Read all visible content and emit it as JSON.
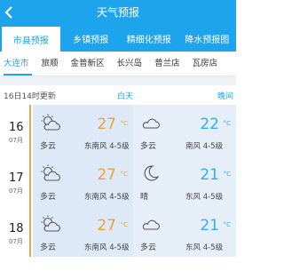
{
  "header": {
    "title": "天气预报"
  },
  "tabs": [
    {
      "label": "市县预报",
      "active": true
    },
    {
      "label": "乡镇预报",
      "active": false
    },
    {
      "label": "精细化预报",
      "active": false
    },
    {
      "label": "降水预报图",
      "active": false
    }
  ],
  "districts": [
    "大连市",
    "旅顺",
    "金普新区",
    "长兴岛",
    "普兰店",
    "瓦房店"
  ],
  "update": {
    "text": "16日14时更新",
    "day_label": "白天",
    "night_label": "晚间"
  },
  "temp_unit": "°C",
  "days": [
    {
      "date": "16",
      "month": "07月",
      "day": {
        "icon": "partly-cloudy-icon",
        "condition": "多云",
        "temp": "27",
        "wind": "东南风  4-5级"
      },
      "night": {
        "icon": "cloudy-icon",
        "condition": "多云",
        "temp": "22",
        "wind": "南风  4-5级"
      }
    },
    {
      "date": "17",
      "month": "07月",
      "day": {
        "icon": "partly-cloudy-icon",
        "condition": "多云",
        "temp": "27",
        "wind": "东南风  4-5级"
      },
      "night": {
        "icon": "moon-icon",
        "condition": "晴",
        "temp": "21",
        "wind": "东风  4-5级"
      }
    },
    {
      "date": "18",
      "month": "07月",
      "day": {
        "icon": "partly-cloudy-icon",
        "condition": "多云",
        "temp": "27",
        "wind": "东南风  4-5级"
      },
      "night": {
        "icon": "cloudy-icon",
        "condition": "多云",
        "temp": "21",
        "wind": "东风  4-5级"
      }
    }
  ],
  "colors": {
    "brand": "#1ea4ec",
    "day_temp": "#e9a23b",
    "night_temp": "#2db0ef",
    "date_accent": "#f0a54a"
  }
}
